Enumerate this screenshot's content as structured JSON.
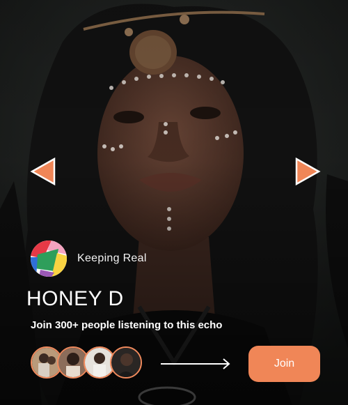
{
  "community": {
    "name": "Keeping Real"
  },
  "echo": {
    "title": "HONEY D",
    "subtitle": "Join 300+ people listening to this echo"
  },
  "actions": {
    "join_label": "Join"
  },
  "icons": {
    "prev": "chevron-left-icon",
    "next": "chevron-right-icon",
    "arrow": "arrow-right-icon"
  },
  "colors": {
    "accent": "#f08657",
    "text": "#ffffff",
    "avatar_ring": "#f08a5d"
  }
}
